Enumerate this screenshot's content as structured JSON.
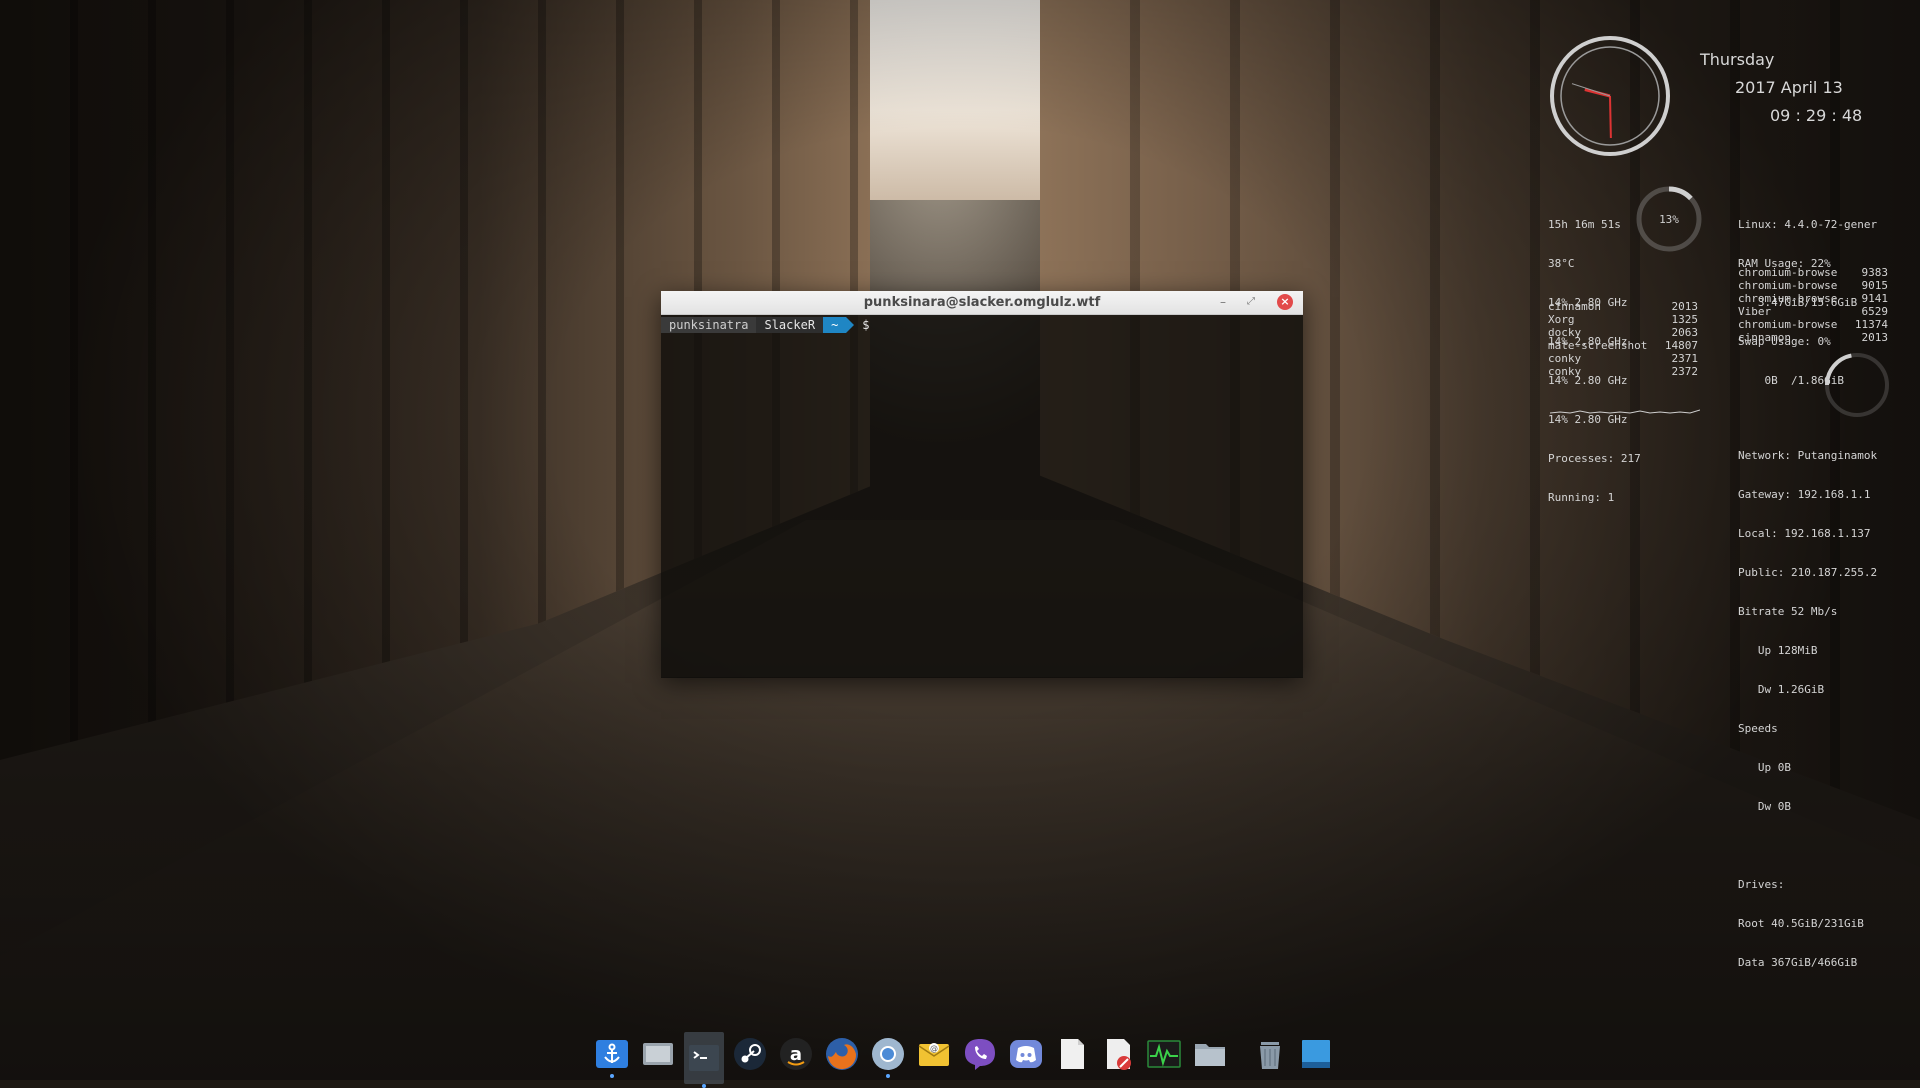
{
  "conky": {
    "clock": {
      "day": "Thursday",
      "date": "2017 April 13",
      "time": "09 : 29 : 48"
    },
    "system_left": {
      "uptime": "15h 16m 51s",
      "temp": "38°C",
      "cpus": [
        "14% 2.80 GHz",
        "14% 2.80 GHz",
        "14% 2.80 GHz",
        "14% 2.80 GHz"
      ],
      "processes": "Processes: 217",
      "running": "Running: 1",
      "cpu_gauge_label": "13%",
      "cpu_gauge_value": 13
    },
    "top_cpu": [
      {
        "name": "cinnamon",
        "pid": "2013"
      },
      {
        "name": "Xorg",
        "pid": "1325"
      },
      {
        "name": "docky",
        "pid": "2063"
      },
      {
        "name": "mate-screenshot",
        "pid": "14807"
      },
      {
        "name": "conky",
        "pid": "2371"
      },
      {
        "name": "conky",
        "pid": "2372"
      }
    ],
    "system_right": {
      "linux": "Linux: 4.4.0-72-gener",
      "ram": "RAM Usage: 22%",
      "ram_detail": "   3.47GiB/15.6GiB",
      "swap": "Swap Usage: 0%",
      "swap_detail": "    0B  /1.86GiB",
      "ram_gauge_value": 22
    },
    "top_mem": [
      {
        "name": "chromium-browse",
        "pid": "9383"
      },
      {
        "name": "chromium-browse",
        "pid": "9015"
      },
      {
        "name": "chromium-browse",
        "pid": "9141"
      },
      {
        "name": "Viber",
        "pid": "6529"
      },
      {
        "name": "chromium-browse",
        "pid": "11374"
      },
      {
        "name": "cinnamon",
        "pid": "2013"
      }
    ],
    "network": {
      "network": "Network: Putanginamok",
      "gateway": "Gateway: 192.168.1.1",
      "local": "Local: 192.168.1.137",
      "public": "Public: 210.187.255.2",
      "bitrate": "Bitrate 52 Mb/s",
      "up_total": "   Up 128MiB",
      "dw_total": "   Dw 1.26GiB",
      "speeds": "Speeds",
      "up_speed": "   Up 0B",
      "dw_speed": "   Dw 0B",
      "drives": "Drives:",
      "root": "Root 40.5GiB/231GiB",
      "data": "Data 367GiB/466GiB"
    }
  },
  "terminal": {
    "title": "punksinara@slacker.omglulz.wtf",
    "buttons": {
      "minimize": "–",
      "maximize": "⤢",
      "close": "×"
    },
    "prompt": {
      "user": "punksinatra",
      "host": "SlackeR",
      "dir": "~",
      "symbol": "$"
    }
  },
  "dock": {
    "items": [
      {
        "id": "installer",
        "icon": "anchor-icon",
        "color": "#2f7fe0",
        "running": true
      },
      {
        "id": "screenshot",
        "icon": "screenshot-icon",
        "color": "#9aa4ad",
        "running": false
      },
      {
        "id": "terminal",
        "icon": "terminal-icon",
        "color": "#3c4650",
        "running": true,
        "active": true
      },
      {
        "id": "steam",
        "icon": "steam-icon",
        "color": "#1b2838",
        "running": false
      },
      {
        "id": "amazon",
        "icon": "amazon-icon",
        "color": "#222222",
        "running": false
      },
      {
        "id": "firefox",
        "icon": "firefox-icon",
        "color": "#e8721c",
        "running": false
      },
      {
        "id": "chromium",
        "icon": "chromium-icon",
        "color": "#4c8bd6",
        "running": true
      },
      {
        "id": "mail",
        "icon": "mail-icon",
        "color": "#f1c232",
        "running": false
      },
      {
        "id": "viber",
        "icon": "viber-icon",
        "color": "#7d4ec1",
        "running": false
      },
      {
        "id": "discord",
        "icon": "discord-icon",
        "color": "#7289da",
        "running": false
      },
      {
        "id": "text-editor",
        "icon": "document-icon",
        "color": "#f0f0f0",
        "running": false
      },
      {
        "id": "disk-tool",
        "icon": "disk-tool-icon",
        "color": "#d93a3a",
        "running": false
      },
      {
        "id": "system-monitor",
        "icon": "system-monitor-icon",
        "color": "#2a8a3a",
        "running": false
      },
      {
        "id": "files",
        "icon": "folder-icon",
        "color": "#9aa7b3",
        "running": false
      },
      {
        "id": "trash",
        "icon": "trash-icon",
        "color": "#8a9aa8",
        "running": false
      },
      {
        "id": "desktop",
        "icon": "show-desktop-icon",
        "color": "#3a9ae0",
        "running": false
      }
    ]
  }
}
